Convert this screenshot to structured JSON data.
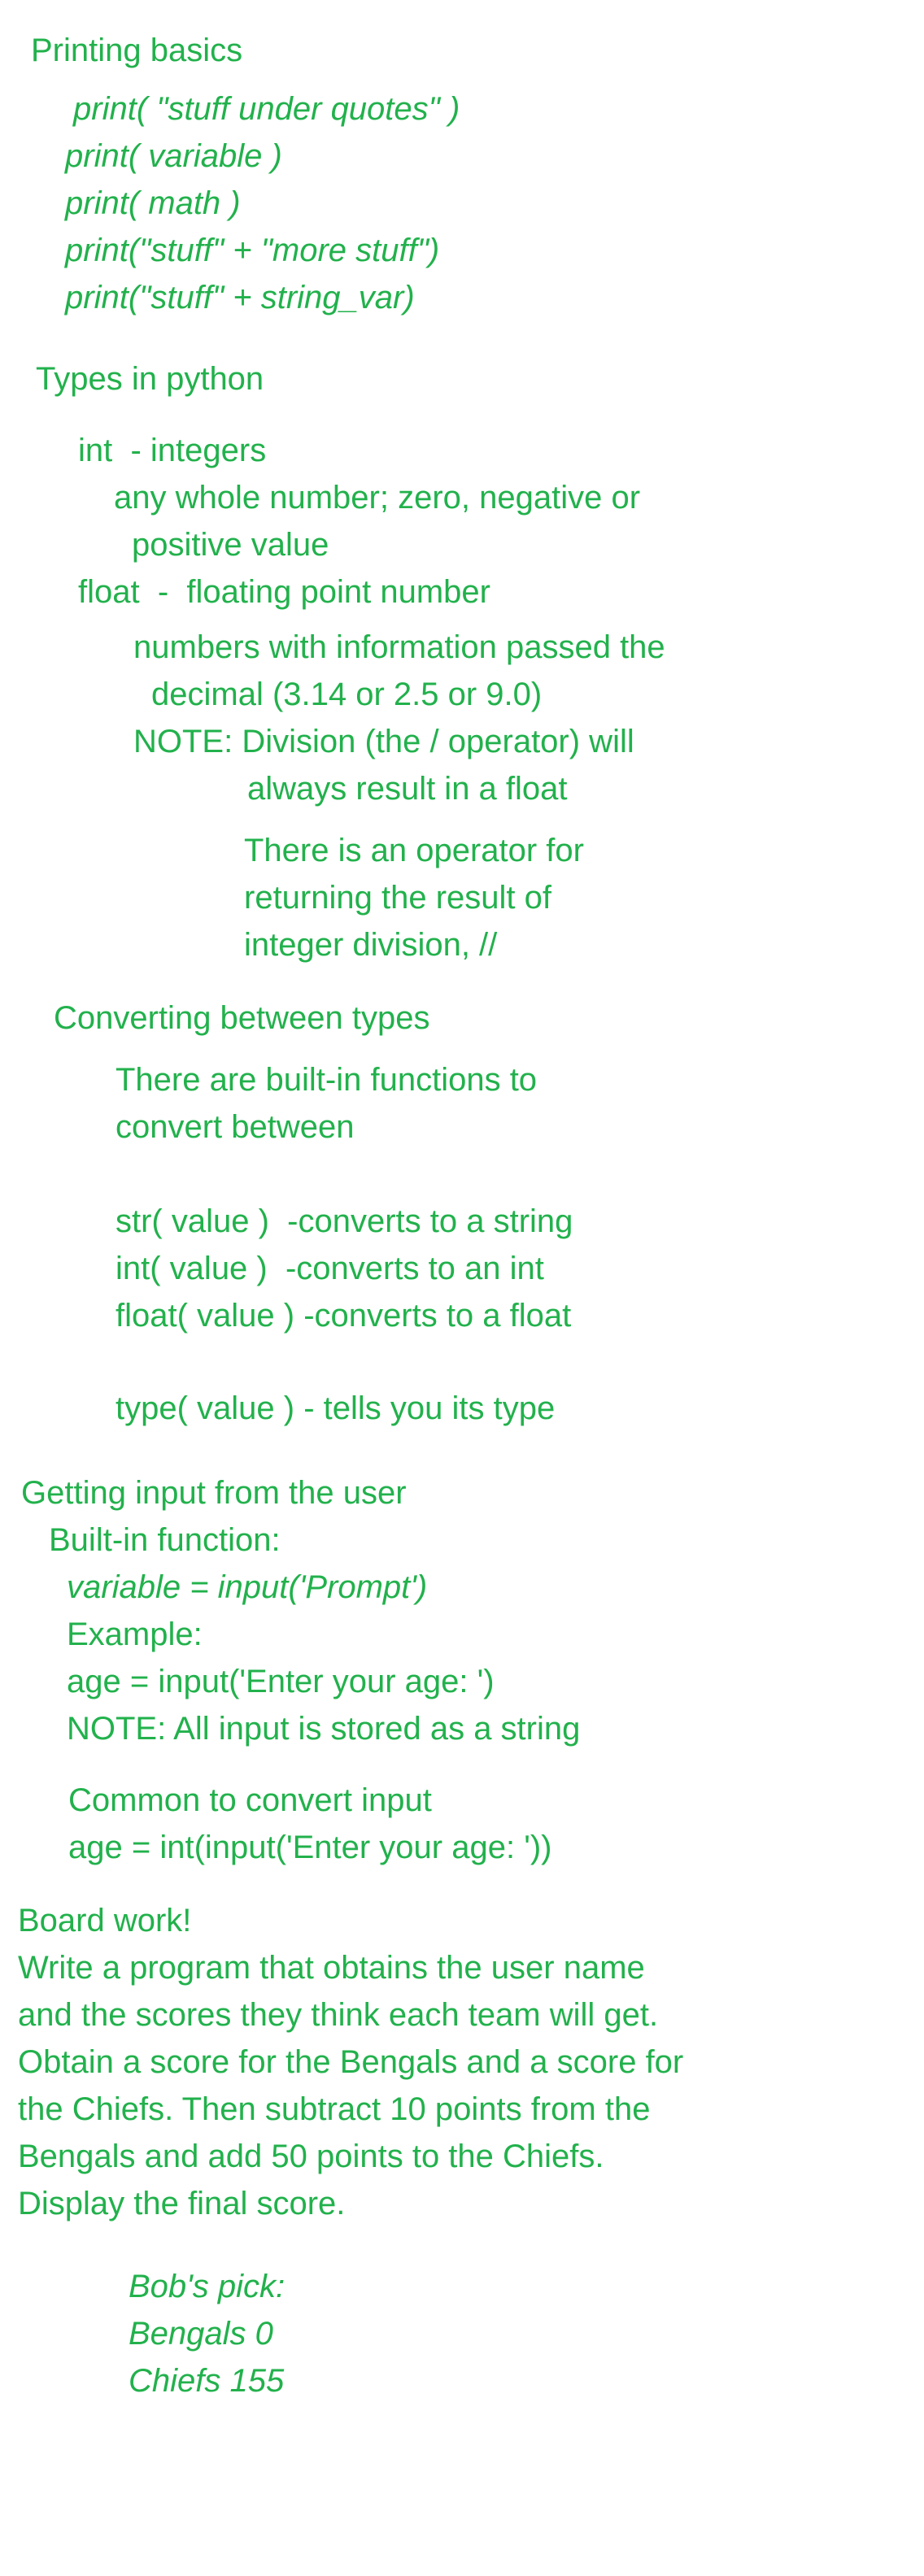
{
  "colors": {
    "ink": "#22b14c",
    "background": "#ffffff"
  },
  "printing": {
    "heading": "Printing basics",
    "lines": [
      "print( \"stuff under quotes\" )",
      "print( variable )",
      "print( math )",
      "print(\"stuff\" + \"more stuff\")",
      "print(\"stuff\" + string_var)"
    ]
  },
  "types": {
    "heading": "Types in python",
    "int_title": "int  - integers",
    "int_desc": [
      "any whole number; zero, negative or",
      "positive value"
    ],
    "float_title": "float  -  floating point number",
    "float_desc": [
      "numbers with information passed the",
      "decimal (3.14 or 2.5 or 9.0)"
    ],
    "note": [
      "NOTE: Division (the / operator) will",
      "always result in a float"
    ],
    "operator_note": [
      "There is an operator for",
      "returning the result of",
      "integer division, //"
    ]
  },
  "converting": {
    "heading": "Converting between types",
    "intro": [
      "There are built-in functions to",
      "convert between"
    ],
    "functions": [
      "str( value )  -converts to a string",
      "int( value )  -converts to an int",
      "float( value ) -converts to a float"
    ],
    "type_fn": "type( value ) - tells you its type"
  },
  "input": {
    "heading": "Getting input from the user",
    "builtin": "Built-in function:",
    "syntax": "variable = input('Prompt')",
    "example_label": "Example:",
    "example": "age = input('Enter your age: ')",
    "note": "NOTE: All input is stored as a string",
    "common_label": "Common to convert input",
    "common_example": "age = int(input('Enter your age: '))"
  },
  "board": {
    "heading": "Board work!",
    "text": [
      "Write a program that obtains the user name",
      "and the scores they think each team will get.",
      "Obtain a score for the Bengals and a score for",
      "the Chiefs. Then subtract 10 points from the",
      "Bengals and add 50 points to the Chiefs.",
      "Display the final score."
    ],
    "pick": [
      "Bob's pick:",
      "Bengals 0",
      "Chiefs 155"
    ]
  }
}
